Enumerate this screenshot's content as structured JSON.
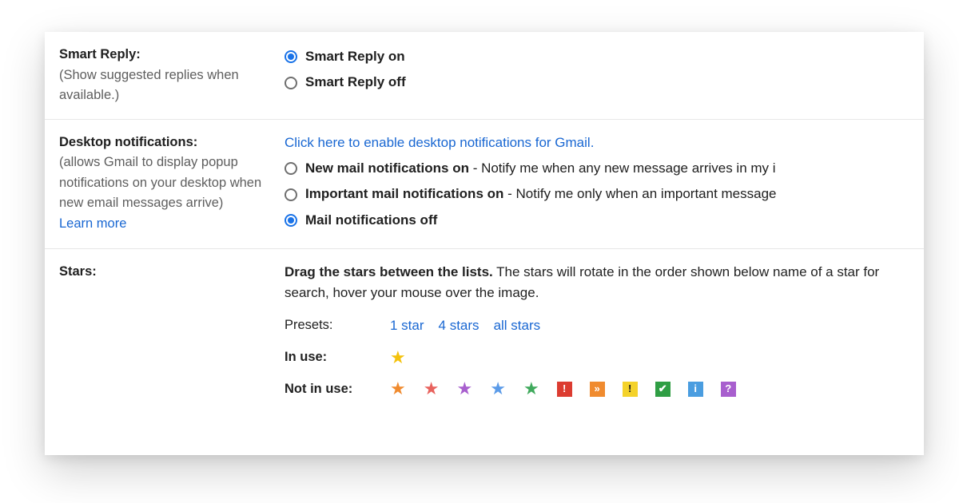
{
  "smart_reply": {
    "title": "Smart Reply:",
    "desc": "(Show suggested replies when available.)",
    "options": {
      "on": "Smart Reply on",
      "off": "Smart Reply off"
    },
    "selected": "on"
  },
  "desktop_notifications": {
    "title": "Desktop notifications:",
    "desc": "(allows Gmail to display popup notifications on your desktop when new email messages arrive)",
    "learn_more": "Learn more",
    "enable_link": "Click here to enable desktop notifications for Gmail.",
    "options": [
      {
        "id": "new",
        "bold": "New mail notifications on",
        "tail": " - Notify me when any new message arrives in my i"
      },
      {
        "id": "important",
        "bold": "Important mail notifications on",
        "tail": " - Notify me only when an important message"
      },
      {
        "id": "off",
        "bold": "Mail notifications off",
        "tail": ""
      }
    ],
    "selected": "off"
  },
  "stars": {
    "title": "Stars:",
    "instruction_bold": "Drag the stars between the lists.",
    "instruction_rest": "  The stars will rotate in the order shown below name of a star for search, hover your mouse over the image.",
    "presets_label": "Presets:",
    "presets": {
      "one": "1 star",
      "four": "4 stars",
      "all": "all stars"
    },
    "in_use_label": "In use:",
    "not_in_use_label": "Not in use:",
    "in_use": [
      {
        "name": "yellow-star",
        "type": "star",
        "color": "#f4c20d"
      }
    ],
    "not_in_use": [
      {
        "name": "orange-star",
        "type": "star",
        "color": "#f08b2f"
      },
      {
        "name": "red-star",
        "type": "star",
        "color": "#e8625d"
      },
      {
        "name": "purple-star",
        "type": "star",
        "color": "#a85fce"
      },
      {
        "name": "blue-star",
        "type": "star",
        "color": "#5b9be8"
      },
      {
        "name": "green-star",
        "type": "star",
        "color": "#3fa95c"
      },
      {
        "name": "red-bang",
        "type": "square",
        "bg": "#dc3c31",
        "glyph": "!",
        "fg": "#ffffff"
      },
      {
        "name": "orange-arrows",
        "type": "square",
        "bg": "#f08b2f",
        "glyph": "»",
        "fg": "#ffffff"
      },
      {
        "name": "yellow-bang",
        "type": "square",
        "bg": "#f4d22a",
        "glyph": "!",
        "fg": "#1a1a1a"
      },
      {
        "name": "green-check",
        "type": "square",
        "bg": "#2f9e44",
        "glyph": "✔",
        "fg": "#ffffff"
      },
      {
        "name": "blue-info",
        "type": "square",
        "bg": "#4a9de0",
        "glyph": "i",
        "fg": "#ffffff"
      },
      {
        "name": "purple-question",
        "type": "square",
        "bg": "#a85fce",
        "glyph": "?",
        "fg": "#ffffff"
      }
    ]
  }
}
